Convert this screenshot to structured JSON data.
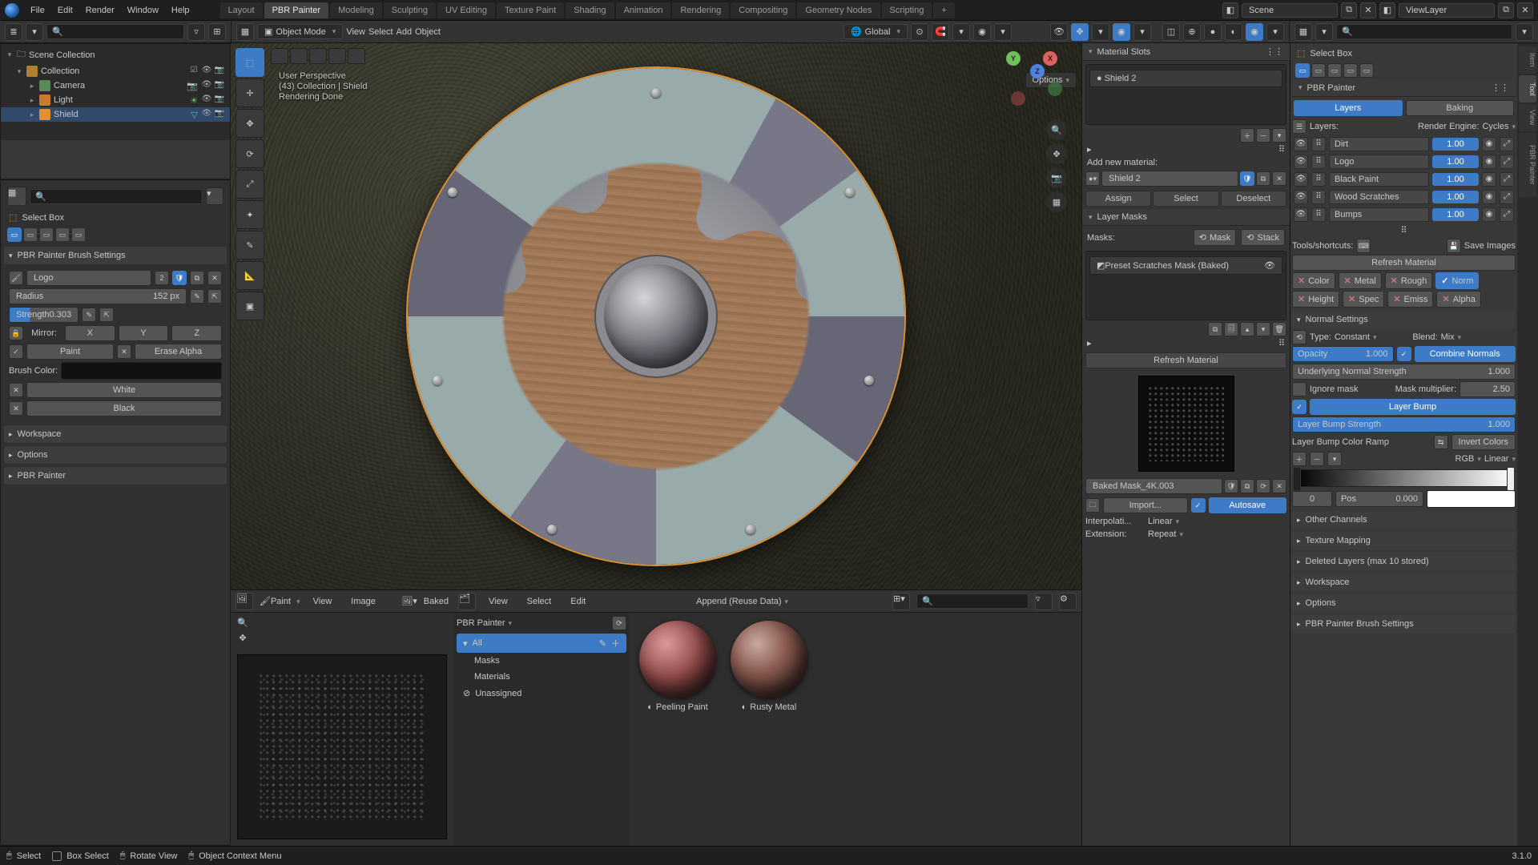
{
  "app": {
    "version": "3.1.0"
  },
  "menu": [
    "File",
    "Edit",
    "Render",
    "Window",
    "Help"
  ],
  "workspaces": [
    "Layout",
    "PBR Painter",
    "Modeling",
    "Sculpting",
    "UV Editing",
    "Texture Paint",
    "Shading",
    "Animation",
    "Rendering",
    "Compositing",
    "Geometry Nodes",
    "Scripting"
  ],
  "active_workspace": "PBR Painter",
  "scene": {
    "name": "Scene",
    "view_layer": "ViewLayer"
  },
  "header3d": {
    "mode": "Object Mode",
    "menus": [
      "View",
      "Select",
      "Add",
      "Object"
    ],
    "orientation": "Global",
    "options": "Options"
  },
  "overlay": {
    "perspective": "User Perspective",
    "context": "(43) Collection | Shield",
    "render": "Rendering Done"
  },
  "outliner": {
    "root": "Scene Collection",
    "collection": "Collection",
    "items": [
      {
        "name": "Camera",
        "type": "cam"
      },
      {
        "name": "Light",
        "type": "light"
      },
      {
        "name": "Shield",
        "type": "mesh",
        "selected": true
      }
    ]
  },
  "tool": {
    "active": "Select Box"
  },
  "brush_panel": {
    "title": "PBR Painter Brush Settings",
    "brush_name": "Logo",
    "brush_users": "2",
    "radius_label": "Radius",
    "radius": "152 px",
    "strength_label": "Strength",
    "strength": "0.303",
    "mirror_label": "Mirror:",
    "mx": "X",
    "my": "Y",
    "mz": "Z",
    "paint": "Paint",
    "erase": "Erase Alpha",
    "brush_color_label": "Brush Color:",
    "white": "White",
    "black": "Black",
    "sections": [
      "Workspace",
      "Options",
      "PBR Painter"
    ]
  },
  "matprops": {
    "slots_title": "Material Slots",
    "slot": "Shield 2",
    "add_new": "Add new material:",
    "mat_name": "Shield 2",
    "assign": "Assign",
    "select": "Select",
    "deselect": "Deselect",
    "layer_masks": "Layer Masks",
    "masks_label": "Masks:",
    "mask_btn": "Mask",
    "stack_btn": "Stack",
    "mask_item": "Preset Scratches Mask (Baked)",
    "refresh": "Refresh Material",
    "baked_name": "Baked Mask_4K.003",
    "import": "Import...",
    "autosave": "Autosave",
    "interp_label": "Interpolati...",
    "interp": "Linear",
    "ext_label": "Extension:",
    "ext": "Repeat"
  },
  "pbr": {
    "title": "PBR Painter",
    "tab_layers": "Layers",
    "tab_baking": "Baking",
    "layers_label": "Layers:",
    "engine_label": "Render Engine:",
    "engine": "Cycles",
    "layers": [
      {
        "name": "Dirt",
        "val": "1.00"
      },
      {
        "name": "Logo",
        "val": "1.00"
      },
      {
        "name": "Black Paint",
        "val": "1.00"
      },
      {
        "name": "Wood Scratches",
        "val": "1.00"
      },
      {
        "name": "Bumps",
        "val": "1.00"
      }
    ],
    "tools_label": "Tools/shortcuts:",
    "save_images": "Save Images",
    "refresh": "Refresh Material",
    "chan": {
      "color": "Color",
      "metal": "Metal",
      "rough": "Rough",
      "norm": "Norm",
      "height": "Height",
      "spec": "Spec",
      "emiss": "Emiss",
      "alpha": "Alpha"
    },
    "norm_title": "Normal Settings",
    "type_label": "Type:",
    "type": "Constant",
    "blend_label": "Blend:",
    "blend": "Mix",
    "opacity_label": "Opacity",
    "opacity": "1.000",
    "combine": "Combine Normals",
    "under_label": "Underlying Normal Strength",
    "under": "1.000",
    "ignore": "Ignore mask",
    "mult_label": "Mask multiplier:",
    "mult": "2.50",
    "layer_bump": "Layer Bump",
    "lbs_label": "Layer Bump Strength",
    "lbs": "1.000",
    "ramp_label": "Layer Bump Color Ramp",
    "invert": "Invert Colors",
    "rgb": "RGB",
    "linear": "Linear",
    "stop_index": "0",
    "pos_label": "Pos",
    "pos": "0.000",
    "other": "Other Channels",
    "texmap": "Texture Mapping",
    "deleted": "Deleted Layers (max 10 stored)",
    "sections": [
      "Workspace",
      "Options",
      "PBR Painter Brush Settings"
    ]
  },
  "asset": {
    "paint_menu": "Paint",
    "view": "View",
    "image": "Image",
    "baked": "Baked",
    "hdr_view": "View",
    "hdr_select": "Select",
    "hdr_edit": "Edit",
    "append": "Append (Reuse Data)",
    "lib": "PBR Painter",
    "cats": [
      "All",
      "Masks",
      "Materials",
      "Unassigned"
    ],
    "thumbs": [
      {
        "name": "Peeling Paint"
      },
      {
        "name": "Rusty Metal"
      }
    ]
  },
  "status": {
    "select": "Select",
    "box": "Box Select",
    "rotate": "Rotate View",
    "ctx": "Object Context Menu"
  },
  "rtool": {
    "active": "Select Box"
  }
}
